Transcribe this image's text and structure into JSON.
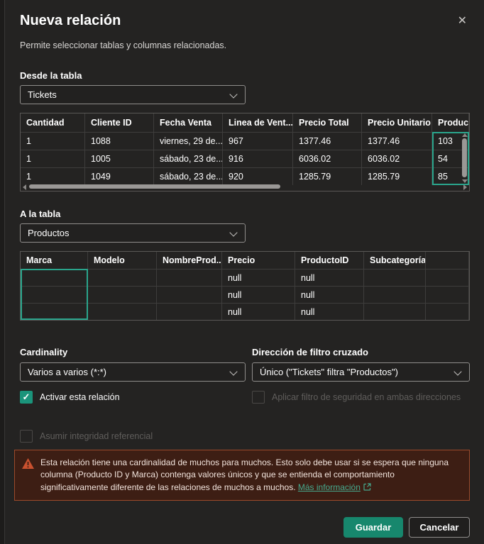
{
  "dialog": {
    "title": "Nueva relación",
    "subtitle": "Permite seleccionar tablas y columnas relacionadas.",
    "close_glyph": "✕"
  },
  "from_table": {
    "label": "Desde la tabla",
    "selected_value": "Tickets",
    "columns": [
      "Cantidad",
      "Cliente ID",
      "Fecha Venta",
      "Linea de Vent...",
      "Precio Total",
      "Precio Unitario",
      "Producto"
    ],
    "rows": [
      [
        "1",
        "1088",
        "viernes, 29 de...",
        "967",
        "1377.46",
        "1377.46",
        "103"
      ],
      [
        "1",
        "1005",
        "sábado, 23 de...",
        "916",
        "6036.02",
        "6036.02",
        "54"
      ],
      [
        "1",
        "1049",
        "sábado, 23 de...",
        "920",
        "1285.79",
        "1285.79",
        "85"
      ]
    ],
    "selected_column": "Producto"
  },
  "to_table": {
    "label": "A la tabla",
    "selected_value": "Productos",
    "columns": [
      "Marca",
      "Modelo",
      "NombreProd...",
      "Precio",
      "ProductoID",
      "Subcategoría",
      ""
    ],
    "rows": [
      [
        "",
        "",
        "",
        "null",
        "null",
        "",
        ""
      ],
      [
        "",
        "",
        "",
        "null",
        "null",
        "",
        ""
      ],
      [
        "",
        "",
        "",
        "null",
        "null",
        "",
        ""
      ]
    ],
    "selected_column": "Marca"
  },
  "cardinality": {
    "label": "Cardinality",
    "selected_value": "Varios a varios (*:*)"
  },
  "cross_filter": {
    "label": "Dirección de filtro cruzado",
    "selected_value": "Único (\"Tickets\" filtra \"Productos\")"
  },
  "checkboxes": {
    "activate": {
      "label": "Activar esta relación",
      "checked": true,
      "disabled": false
    },
    "security": {
      "label": "Aplicar filtro de seguridad en ambas direcciones",
      "checked": false,
      "disabled": true
    },
    "referential": {
      "label": "Asumir integridad referencial",
      "checked": false,
      "disabled": true
    }
  },
  "warning": {
    "text": "Esta relación tiene una cardinalidad de muchos para muchos. Esto solo debe usar si se espera que ninguna columna (Producto ID y Marca) contenga valores únicos y que se entienda el comportamiento significativamente diferente de las relaciones de muchos a muchos. ",
    "link_label": "Más información"
  },
  "buttons": {
    "save": "Guardar",
    "cancel": "Cancelar"
  },
  "colors": {
    "accent": "#17876d",
    "selection": "#2aa58c",
    "checkbox_checked": "#1b947b",
    "link": "#46a98d",
    "warning_bg": "#3d1e14",
    "warning_border": "#9c4a2b",
    "warning_icon": "#c9512f",
    "dialog_bg": "#242322"
  }
}
